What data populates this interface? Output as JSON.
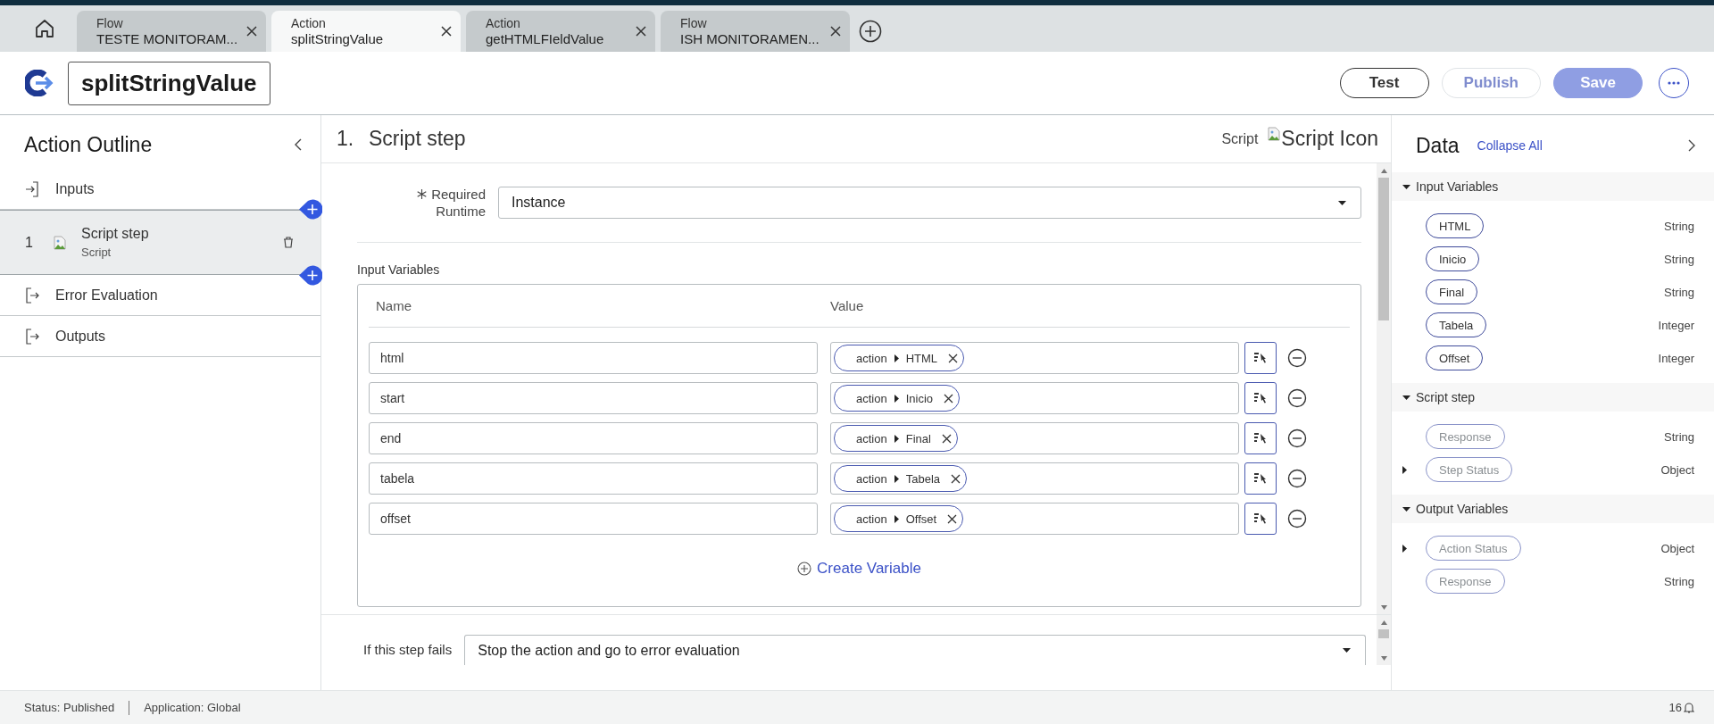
{
  "tabs": [
    {
      "type": "Flow",
      "name": "TESTE MONITORAM...",
      "selected": false
    },
    {
      "type": "Action",
      "name": "splitStringValue",
      "selected": true
    },
    {
      "type": "Action",
      "name": "getHTMLFIeldValue",
      "selected": false
    },
    {
      "type": "Flow",
      "name": "ISH MONITORAMEN...",
      "selected": false
    }
  ],
  "header": {
    "title": "splitStringValue",
    "buttons": [
      {
        "label": "Test",
        "kind": "outline",
        "disabled": false
      },
      {
        "label": "Publish",
        "kind": "outline",
        "disabled": true
      },
      {
        "label": "Save",
        "kind": "primary",
        "disabled": true
      }
    ]
  },
  "outline": {
    "title": "Action Outline",
    "items": [
      {
        "kind": "section",
        "label": "Inputs",
        "selected": false
      },
      {
        "kind": "step",
        "number": "1",
        "label": "Script step",
        "subtitle": "Script",
        "selected": true
      },
      {
        "kind": "section",
        "label": "Error Evaluation",
        "selected": false
      },
      {
        "kind": "section",
        "label": "Outputs",
        "selected": false
      }
    ]
  },
  "step": {
    "number": "1.",
    "title": "Script step",
    "type_label": "Script",
    "icon_alt": "Script Icon",
    "runtime": {
      "label_line1": "Required",
      "label_line2": "Runtime",
      "value": "Instance"
    },
    "input_variables": {
      "title": "Input Variables",
      "columns": [
        "Name",
        "Value"
      ],
      "rows": [
        {
          "name": "html",
          "source": "action",
          "field": "HTML"
        },
        {
          "name": "start",
          "source": "action",
          "field": "Inicio"
        },
        {
          "name": "end",
          "source": "action",
          "field": "Final"
        },
        {
          "name": "tabela",
          "source": "action",
          "field": "Tabela"
        },
        {
          "name": "offset",
          "source": "action",
          "field": "Offset"
        }
      ],
      "create_label": "Create Variable"
    },
    "on_fail": {
      "label": "If this step fails",
      "value": "Stop the action and go to error evaluation"
    }
  },
  "data_panel": {
    "title": "Data",
    "collapse_label": "Collapse All",
    "sections": [
      {
        "title": "Input Variables",
        "expanded": true,
        "items": [
          {
            "name": "HTML",
            "type": "String",
            "disabled": false,
            "expandable": false
          },
          {
            "name": "Inicio",
            "type": "String",
            "disabled": false,
            "expandable": false
          },
          {
            "name": "Final",
            "type": "String",
            "disabled": false,
            "expandable": false
          },
          {
            "name": "Tabela",
            "type": "Integer",
            "disabled": false,
            "expandable": false
          },
          {
            "name": "Offset",
            "type": "Integer",
            "disabled": false,
            "expandable": false
          }
        ]
      },
      {
        "title": "Script step",
        "expanded": true,
        "items": [
          {
            "name": "Response",
            "type": "String",
            "disabled": true,
            "expandable": false
          },
          {
            "name": "Step Status",
            "type": "Object",
            "disabled": true,
            "expandable": true
          }
        ]
      },
      {
        "title": "Output Variables",
        "expanded": true,
        "items": [
          {
            "name": "Action Status",
            "type": "Object",
            "disabled": true,
            "expandable": true
          },
          {
            "name": "Response",
            "type": "String",
            "disabled": true,
            "expandable": false
          }
        ]
      }
    ]
  },
  "status_bar": {
    "status": "Status: Published",
    "application": "Application: Global",
    "notifications": "16"
  }
}
